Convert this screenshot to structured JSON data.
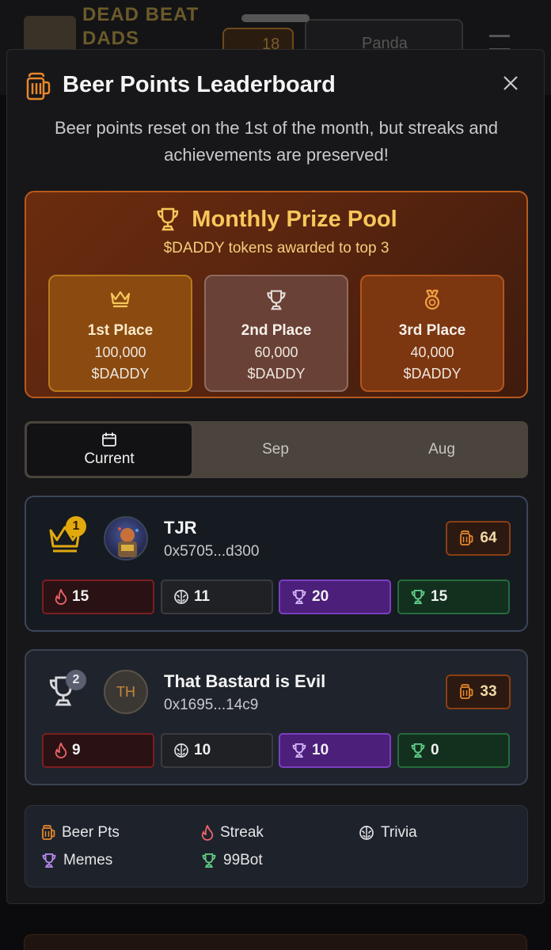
{
  "background": {
    "brand": "DEAD BEAT DADS",
    "beer_count": "18",
    "user_name": "Panda"
  },
  "modal": {
    "title": "Beer Points Leaderboard",
    "subtitle": "Beer points reset on the 1st of the month, but streaks and achievements are preserved!",
    "close_icon": "close-icon"
  },
  "prize_pool": {
    "title": "Monthly Prize Pool",
    "subtitle": "$DADDY tokens awarded to top 3",
    "prizes": [
      {
        "place": "1st Place",
        "amount": "100,000",
        "token": "$DADDY",
        "icon": "crown-icon"
      },
      {
        "place": "2nd Place",
        "amount": "60,000",
        "token": "$DADDY",
        "icon": "trophy-icon"
      },
      {
        "place": "3rd Place",
        "amount": "40,000",
        "token": "$DADDY",
        "icon": "medal-icon"
      }
    ]
  },
  "tabs": [
    {
      "label": "Current",
      "icon": "calendar-icon",
      "active": true
    },
    {
      "label": "Sep",
      "active": false
    },
    {
      "label": "Aug",
      "active": false
    }
  ],
  "entries": [
    {
      "rank": "1",
      "name": "TJR",
      "address": "0x5705...d300",
      "beer_points": "64",
      "streak": "15",
      "trivia": "11",
      "memes": "20",
      "bot": "15"
    },
    {
      "rank": "2",
      "name": "That Bastard is Evil",
      "address": "0x1695...14c9",
      "initials": "TH",
      "beer_points": "33",
      "streak": "9",
      "trivia": "10",
      "memes": "10",
      "bot": "0"
    }
  ],
  "legend": {
    "beer": "Beer Pts",
    "streak": "Streak",
    "trivia": "Trivia",
    "memes": "Memes",
    "bot": "99Bot"
  },
  "colors": {
    "accent_orange": "#e8872a",
    "gold": "#f8c75a",
    "streak": "#f0646a",
    "memes": "#b98af0",
    "bot": "#5fd088"
  }
}
